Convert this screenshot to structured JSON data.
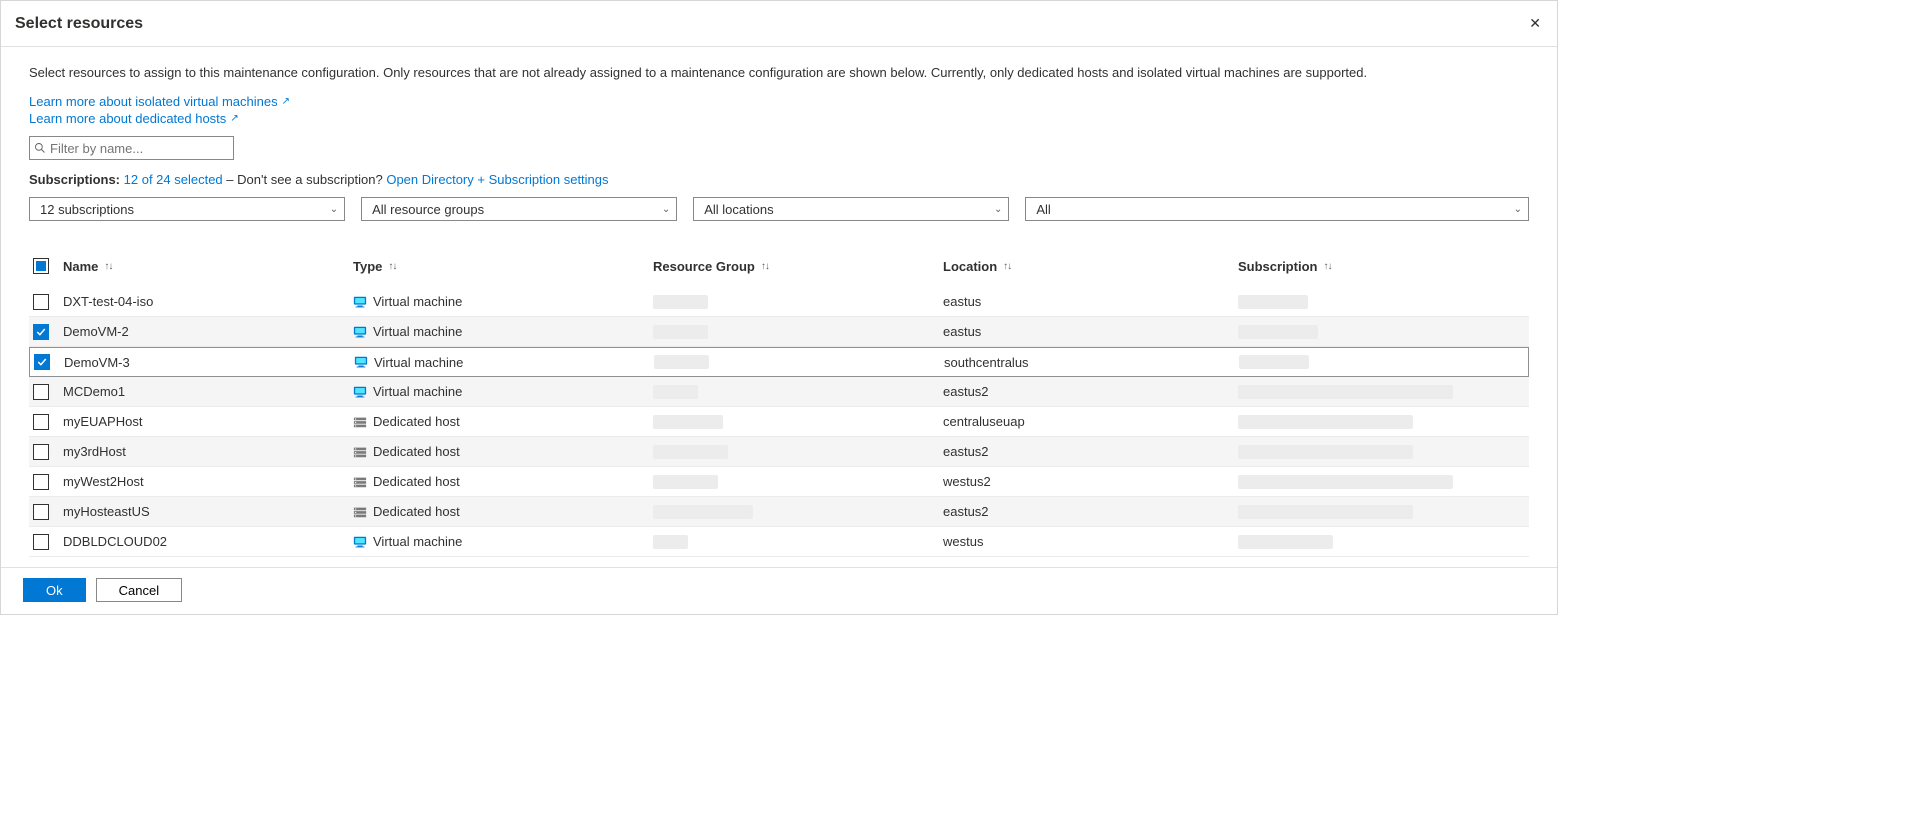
{
  "header": {
    "title": "Select resources"
  },
  "description": "Select resources to assign to this maintenance configuration. Only resources that are not already assigned to a maintenance configuration are shown below. Currently, only dedicated hosts and isolated virtual machines are supported.",
  "links": {
    "isolated_vm": "Learn more about isolated virtual machines",
    "dedicated_hosts": "Learn more about dedicated hosts"
  },
  "filter": {
    "placeholder": "Filter by name..."
  },
  "subscriptions": {
    "label": "Subscriptions:",
    "selected_text": "12 of 24 selected",
    "middle_text": " – Don't see a subscription? ",
    "settings_link": "Open Directory + Subscription settings"
  },
  "dropdowns": {
    "subs": "12 subscriptions",
    "rgs": "All resource groups",
    "locations": "All locations",
    "types": "All"
  },
  "columns": {
    "name": "Name",
    "type": "Type",
    "rg": "Resource Group",
    "location": "Location",
    "subscription": "Subscription"
  },
  "rows": [
    {
      "name": "DXT-test-04-iso",
      "type": "Virtual machine",
      "typeicon": "vm",
      "rg_redact_w": 55,
      "location": "eastus",
      "sub_redact_w": 70,
      "checked": false,
      "alt": false
    },
    {
      "name": "DemoVM-2",
      "type": "Virtual machine",
      "typeicon": "vm",
      "rg_redact_w": 55,
      "location": "eastus",
      "sub_redact_w": 80,
      "checked": true,
      "alt": true
    },
    {
      "name": "DemoVM-3",
      "type": "Virtual machine",
      "typeicon": "vm",
      "rg_redact_w": 55,
      "location": "southcentralus",
      "sub_redact_w": 70,
      "checked": true,
      "alt": false,
      "selected": true
    },
    {
      "name": "MCDemo1",
      "type": "Virtual machine",
      "typeicon": "vm",
      "rg_redact_w": 45,
      "location": "eastus2",
      "sub_redact_w": 215,
      "checked": false,
      "alt": true
    },
    {
      "name": "myEUAPHost",
      "type": "Dedicated host",
      "typeicon": "dh",
      "rg_redact_w": 70,
      "location": "centraluseuap",
      "sub_redact_w": 175,
      "checked": false,
      "alt": false
    },
    {
      "name": "my3rdHost",
      "type": "Dedicated host",
      "typeicon": "dh",
      "rg_redact_w": 75,
      "location": "eastus2",
      "sub_redact_w": 175,
      "checked": false,
      "alt": true
    },
    {
      "name": "myWest2Host",
      "type": "Dedicated host",
      "typeicon": "dh",
      "rg_redact_w": 65,
      "location": "westus2",
      "sub_redact_w": 215,
      "checked": false,
      "alt": false
    },
    {
      "name": "myHosteastUS",
      "type": "Dedicated host",
      "typeicon": "dh",
      "rg_redact_w": 100,
      "location": "eastus2",
      "sub_redact_w": 175,
      "checked": false,
      "alt": true
    },
    {
      "name": "DDBLDCLOUD02",
      "type": "Virtual machine",
      "typeicon": "vm",
      "rg_redact_w": 35,
      "location": "westus",
      "sub_redact_w": 95,
      "checked": false,
      "alt": false
    }
  ],
  "footer": {
    "ok": "Ok",
    "cancel": "Cancel"
  }
}
